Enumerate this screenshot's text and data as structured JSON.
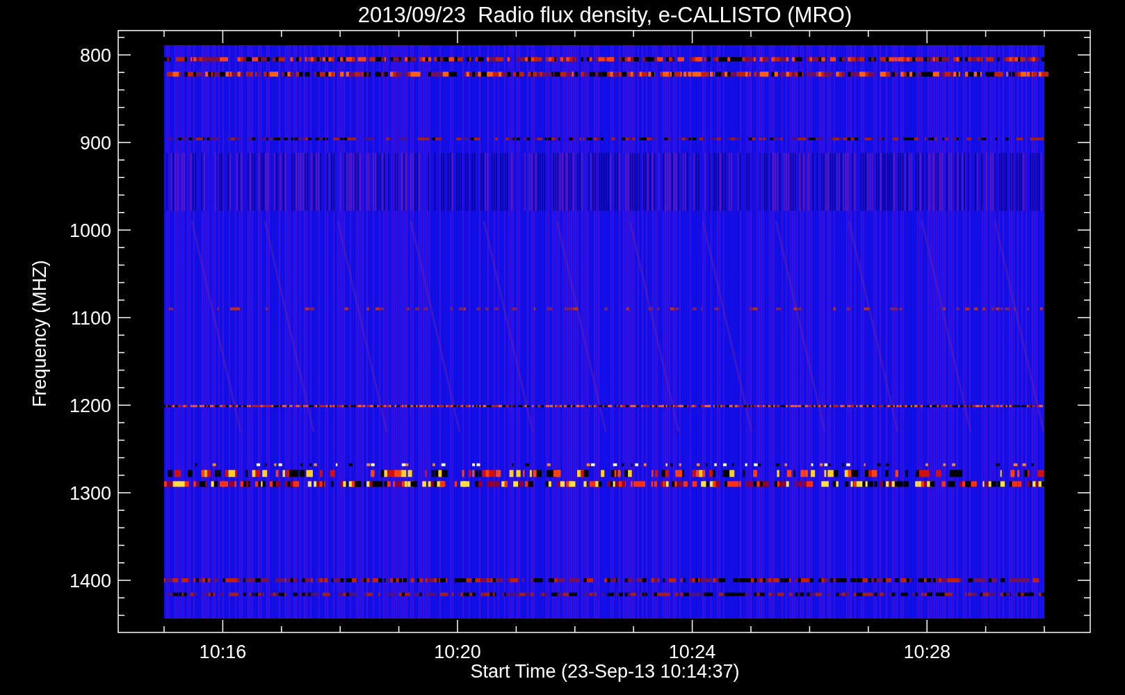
{
  "plot": {
    "title": "2013/09/23  Radio flux density, e-CALLISTO (MRO)",
    "xlabel": "Start Time (23-Sep-13 10:14:37)",
    "ylabel": "Frequency (MHZ)",
    "yticks": [
      "800",
      "900",
      "1000",
      "1100",
      "1200",
      "1300",
      "1400"
    ],
    "xticks": [
      "10:16",
      "10:20",
      "10:24",
      "10:28"
    ]
  }
}
